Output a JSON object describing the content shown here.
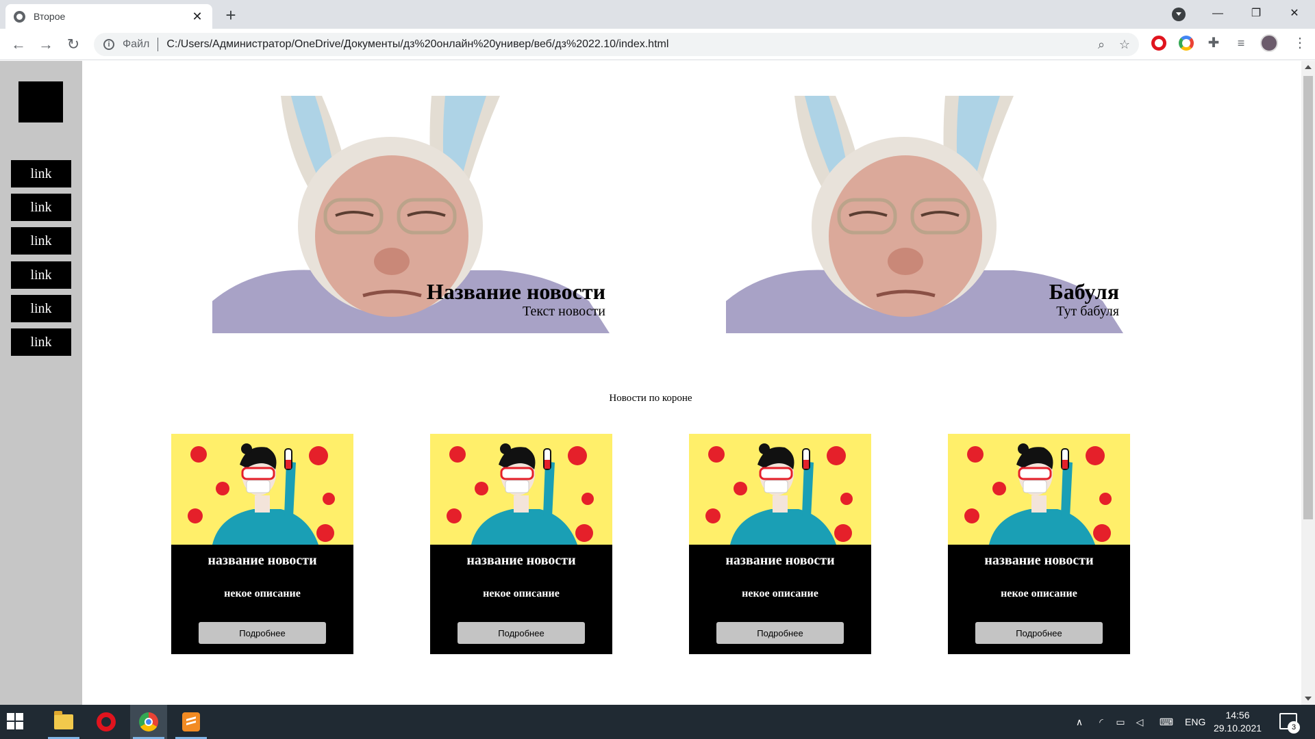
{
  "browser": {
    "tab_title": "Второе",
    "address_prefix": "Файл",
    "url": "C:/Users/Администратор/OneDrive/Документы/дз%20онлайн%20универ/веб/дз%2022.10/index.html"
  },
  "sidebar": {
    "links": [
      {
        "label": "link"
      },
      {
        "label": "link"
      },
      {
        "label": "link"
      },
      {
        "label": "link"
      },
      {
        "label": "link"
      },
      {
        "label": "link"
      }
    ]
  },
  "hero": [
    {
      "title": "Название новости",
      "text": "Текст новости"
    },
    {
      "title": "Бабуля",
      "text": "Тут бабуля"
    }
  ],
  "section": {
    "title": "Новости по короне"
  },
  "cards": [
    {
      "title": "название новости",
      "description": "некое описание",
      "button": "Подробнее"
    },
    {
      "title": "название новости",
      "description": "некое описание",
      "button": "Подробнее"
    },
    {
      "title": "название новости",
      "description": "некое описание",
      "button": "Подробнее"
    },
    {
      "title": "название новости",
      "description": "некое описание",
      "button": "Подробнее"
    }
  ],
  "taskbar": {
    "language": "ENG",
    "time": "14:56",
    "date": "29.10.2021",
    "notification_count": "3"
  },
  "colors": {
    "sidebar_bg": "#c6c6c6",
    "card_bg": "#000000",
    "card_image_bg": "#ffef6a",
    "button_bg": "#c4c4c4",
    "taskbar_bg": "#202a33"
  }
}
